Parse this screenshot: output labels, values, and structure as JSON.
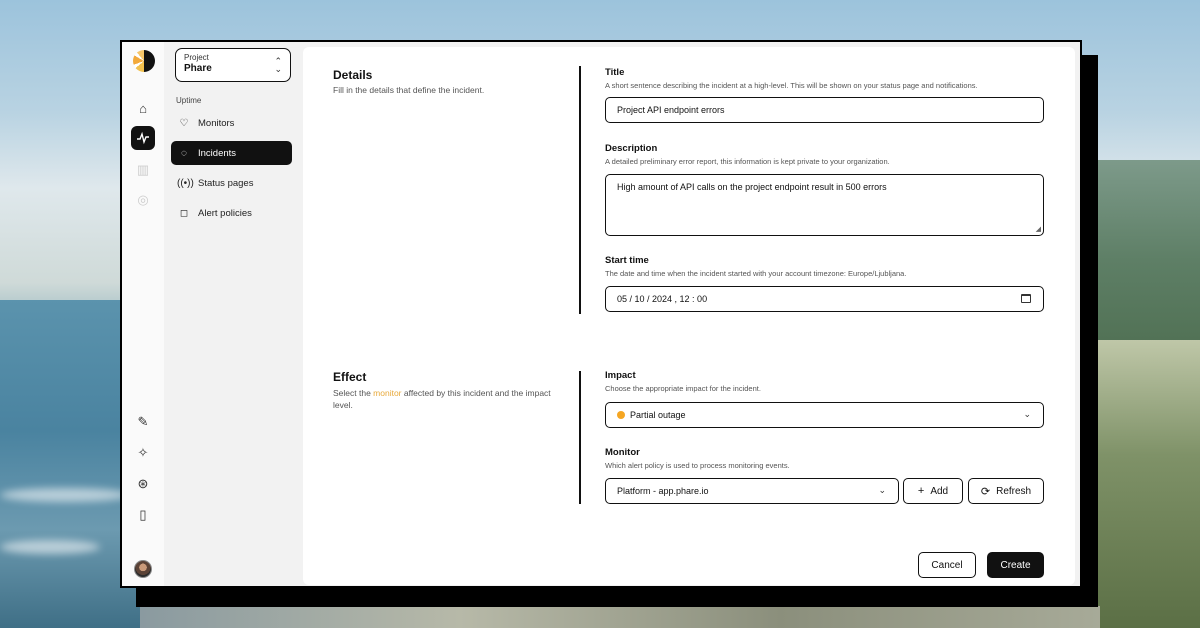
{
  "project": {
    "label": "Project",
    "name": "Phare"
  },
  "sidebar": {
    "section": "Uptime",
    "items": [
      {
        "label": "Monitors",
        "icon": "heart-pulse-icon"
      },
      {
        "label": "Incidents",
        "icon": "flame-icon"
      },
      {
        "label": "Status pages",
        "icon": "broadcast-icon"
      },
      {
        "label": "Alert policies",
        "icon": "bell-icon"
      }
    ]
  },
  "details": {
    "title": "Details",
    "desc": "Fill in the details that define the incident.",
    "fields": {
      "title": {
        "label": "Title",
        "help": "A short sentence describing the incident at a high-level. This will be shown on your status page and notifications.",
        "value": "Project API endpoint errors"
      },
      "description": {
        "label": "Description",
        "help": "A detailed preliminary error report, this information is kept private to your organization.",
        "value": "High amount of API calls on the project endpoint result in 500 errors"
      },
      "start_time": {
        "label": "Start time",
        "help": "The date and time when the incident started with your account timezone: Europe/Ljubljana.",
        "value": "05 / 10 / 2024 ,  12 : 00"
      }
    }
  },
  "effect": {
    "title": "Effect",
    "desc_pre": "Select the ",
    "desc_link": "monitor",
    "desc_post": " affected by this incident and the impact level.",
    "impact": {
      "label": "Impact",
      "help": "Choose the appropriate impact for the incident.",
      "value": "Partial outage",
      "color": "#f5a623"
    },
    "monitor": {
      "label": "Monitor",
      "help": "Which alert policy is used to process monitoring events.",
      "value": "Platform - app.phare.io"
    }
  },
  "buttons": {
    "add": "Add",
    "refresh": "Refresh",
    "cancel": "Cancel",
    "create": "Create"
  }
}
